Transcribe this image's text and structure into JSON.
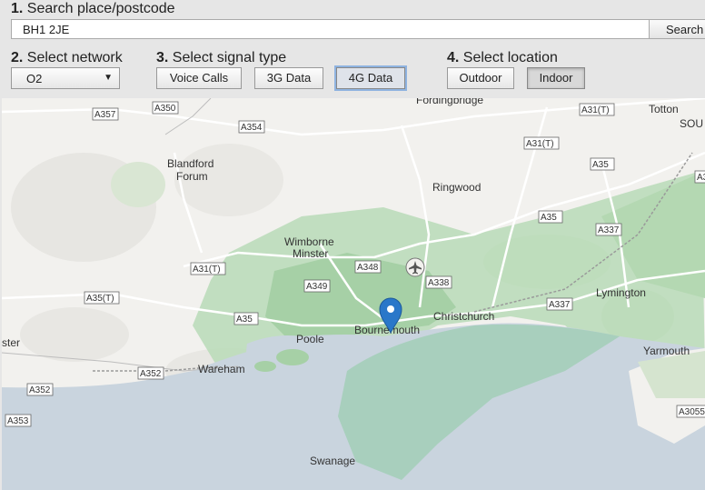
{
  "steps": {
    "search": {
      "number": "1.",
      "title": "Search place/postcode",
      "value": "BH1 2JE",
      "button": "Search"
    },
    "network": {
      "number": "2.",
      "title": "Select network",
      "selected": "O2"
    },
    "signal": {
      "number": "3.",
      "title": "Select signal type",
      "options": [
        "Voice Calls",
        "3G Data",
        "4G Data"
      ],
      "selected": "4G Data"
    },
    "location": {
      "number": "4.",
      "title": "Select location",
      "options": [
        "Outdoor",
        "Indoor"
      ],
      "selected": "Indoor"
    }
  },
  "map": {
    "places": [
      "Fordingbridge",
      "Totton",
      "SOU",
      "Blandford",
      "Forum",
      "Ringwood",
      "Wimborne",
      "Minster",
      "Lymington",
      "Christchurch",
      "Bournemouth",
      "Poole",
      "Yarmouth",
      "Wareham",
      "Swanage",
      "ster"
    ],
    "roads": [
      "A357",
      "A350",
      "A354",
      "A31(T)",
      "A31(T)",
      "A35",
      "A35",
      "A337",
      "A348",
      "A349",
      "A338",
      "A337",
      "A35",
      "A35(T)",
      "A31(T)",
      "A352",
      "A352",
      "A353",
      "A3055",
      "A3"
    ],
    "marker": "map-pin-icon",
    "airport": "airport-icon",
    "colors": {
      "land": "#f2f1ee",
      "sea": "#c9d4de",
      "coverage": "#a9d1a9",
      "road": "#ffffff"
    }
  }
}
